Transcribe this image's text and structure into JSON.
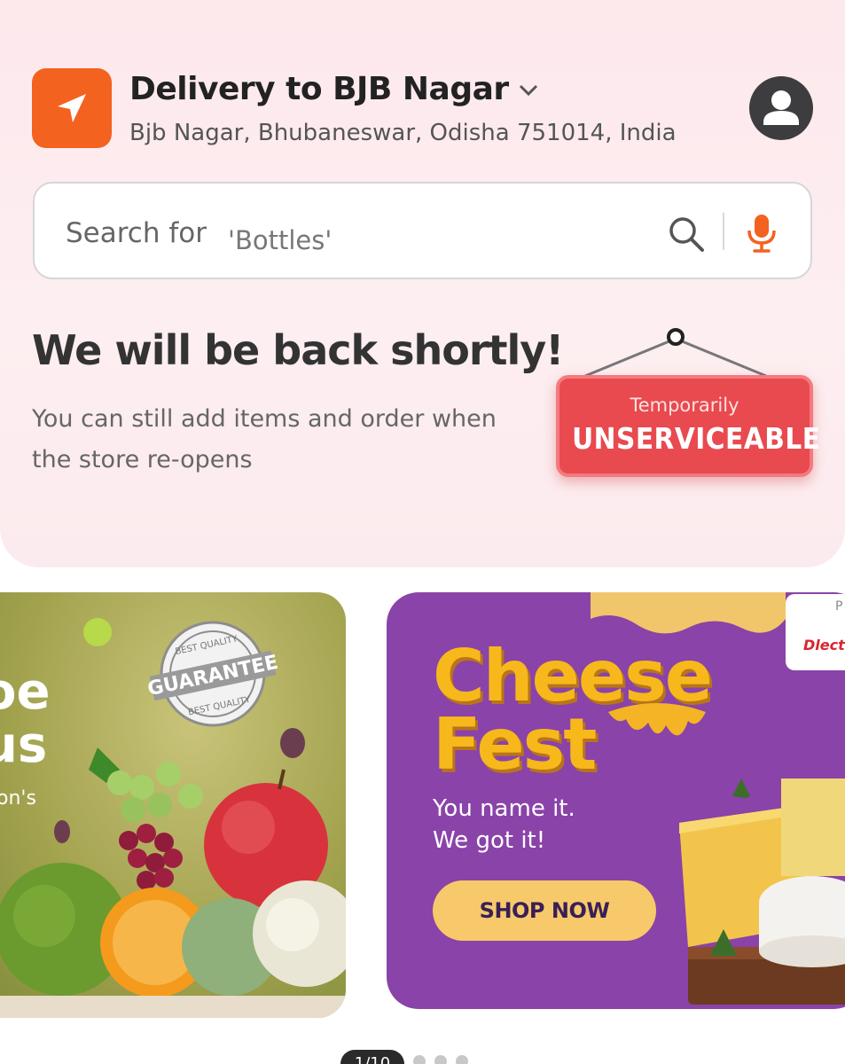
{
  "header": {
    "title": "Delivery to BJB Nagar",
    "address": "Bjb Nagar, Bhubaneswar, Odisha 751014, India",
    "location_icon": "navigation-arrow-icon",
    "profile_icon": "user-avatar-icon"
  },
  "search": {
    "prefix": "Search for",
    "term": "'Bottles'",
    "search_icon": "search-icon",
    "mic_icon": "microphone-icon"
  },
  "status": {
    "title": "We will be back shortly!",
    "subtitle": "You can still add items and order when the store re-opens",
    "sign_small": "Temporarily",
    "sign_big": "UNSERVICEABLE"
  },
  "banners": [
    {
      "line1": "oe",
      "line2": "us",
      "small": "on's",
      "badge_top": "BEST QUALITY",
      "badge_mid": "GUARANTEE",
      "badge_bottom": "BEST QUALITY"
    },
    {
      "headline1": "Cheese",
      "headline2": "Fest",
      "tagline1": "You name it.",
      "tagline2": "We got it!",
      "button": "SHOP NOW",
      "brand": "Dlecta",
      "brand_prefix": "P"
    }
  ],
  "pager": {
    "label": "1/10"
  },
  "colors": {
    "accent": "#f4621f",
    "sign_red": "#e84a4f",
    "banner_purple": "#8a43a8",
    "cheese_yellow": "#f7b81c"
  }
}
